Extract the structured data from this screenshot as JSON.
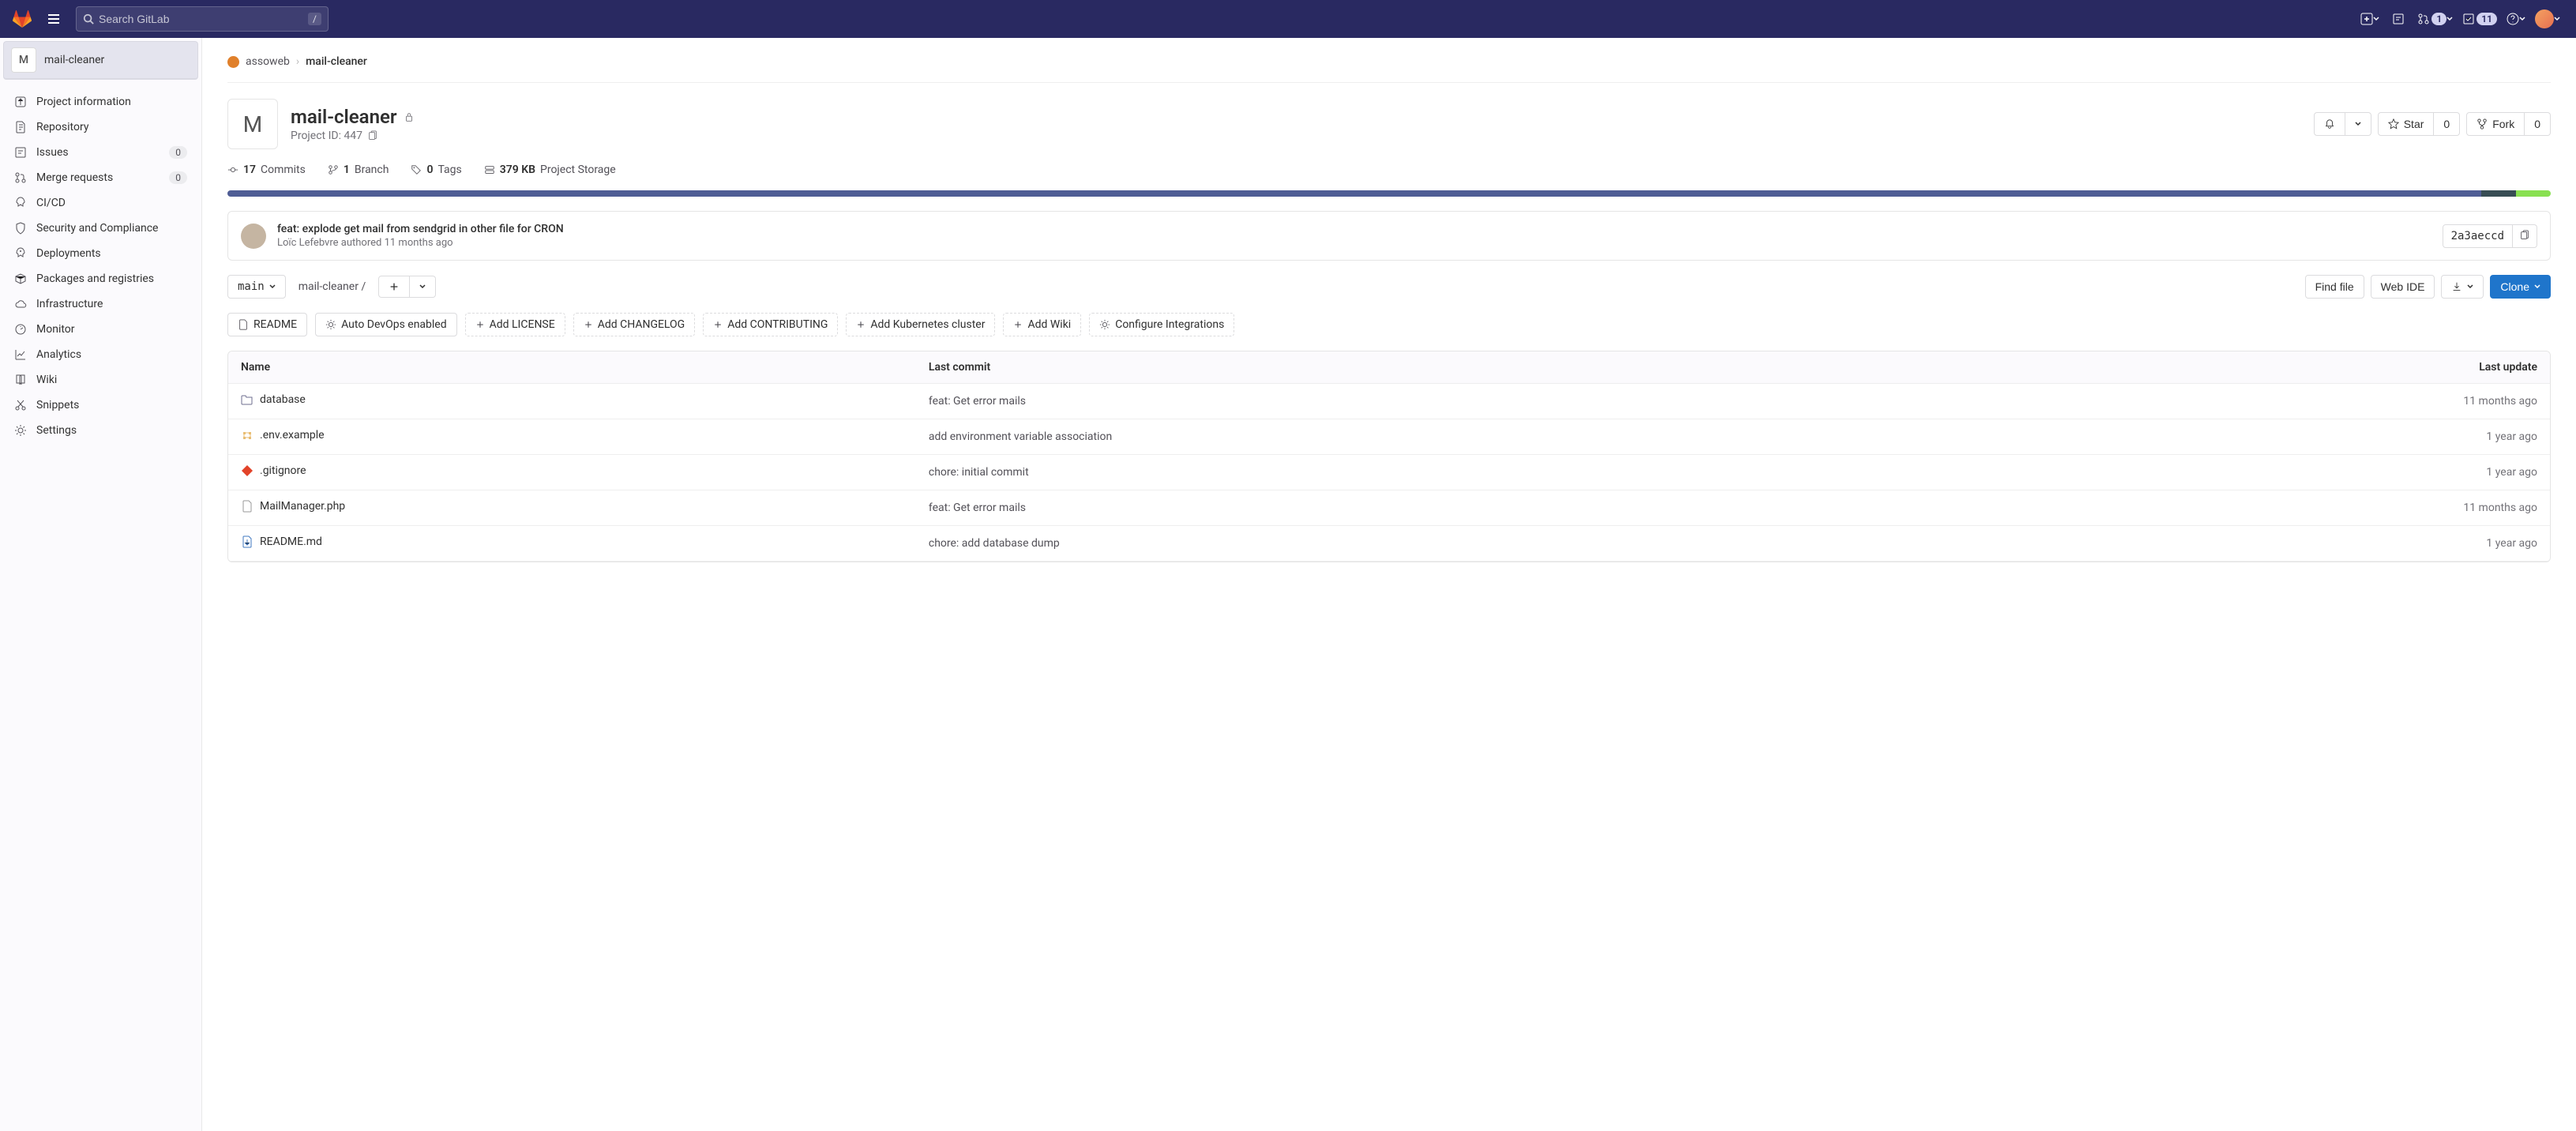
{
  "navbar": {
    "search_placeholder": "Search GitLab",
    "search_kbd": "/",
    "merge_badge": "1",
    "todo_badge": "11"
  },
  "sidebar": {
    "project_initial": "M",
    "project_name": "mail-cleaner",
    "items": [
      {
        "label": "Project information",
        "icon": "info"
      },
      {
        "label": "Repository",
        "icon": "repo"
      },
      {
        "label": "Issues",
        "icon": "issues",
        "count": "0"
      },
      {
        "label": "Merge requests",
        "icon": "merge",
        "count": "0"
      },
      {
        "label": "CI/CD",
        "icon": "rocket"
      },
      {
        "label": "Security and Compliance",
        "icon": "shield"
      },
      {
        "label": "Deployments",
        "icon": "deploy"
      },
      {
        "label": "Packages and registries",
        "icon": "package"
      },
      {
        "label": "Infrastructure",
        "icon": "cloud"
      },
      {
        "label": "Monitor",
        "icon": "monitor"
      },
      {
        "label": "Analytics",
        "icon": "chart"
      },
      {
        "label": "Wiki",
        "icon": "book"
      },
      {
        "label": "Snippets",
        "icon": "snippet"
      },
      {
        "label": "Settings",
        "icon": "gear"
      }
    ]
  },
  "breadcrumbs": {
    "group": "assoweb",
    "project": "mail-cleaner"
  },
  "hero": {
    "initial": "M",
    "title": "mail-cleaner",
    "project_id_label": "Project ID: 447",
    "star_label": "Star",
    "star_count": "0",
    "fork_label": "Fork",
    "fork_count": "0"
  },
  "stats": {
    "commits_count": "17",
    "commits_label": "Commits",
    "branches_count": "1",
    "branches_label": "Branch",
    "tags_count": "0",
    "tags_label": "Tags",
    "storage_size": "379 KB",
    "storage_label": "Project Storage"
  },
  "lang_bar": [
    {
      "color": "#4f5d95",
      "width": "97%"
    },
    {
      "color": "#384d54",
      "width": "1.5%"
    },
    {
      "color": "#89e051",
      "width": "1.5%"
    }
  ],
  "commit": {
    "message": "feat: explode get mail from sendgrid in other file for CRON",
    "author": "Loïc Lefebvre",
    "authored_word": "authored",
    "time": "11 months ago",
    "sha": "2a3aeccd"
  },
  "file_nav": {
    "branch": "main",
    "path": "mail-cleaner",
    "path_sep": "/",
    "find_file": "Find file",
    "web_ide": "Web IDE",
    "clone": "Clone"
  },
  "chips": {
    "readme": "README",
    "auto_devops": "Auto DevOps enabled",
    "add_license": "Add LICENSE",
    "add_changelog": "Add CHANGELOG",
    "add_contributing": "Add CONTRIBUTING",
    "add_k8s": "Add Kubernetes cluster",
    "add_wiki": "Add Wiki",
    "configure": "Configure Integrations"
  },
  "table": {
    "col_name": "Name",
    "col_commit": "Last commit",
    "col_update": "Last update",
    "rows": [
      {
        "icon": "folder",
        "name": "database",
        "commit": "feat: Get error mails",
        "date": "11 months ago"
      },
      {
        "icon": "env",
        "name": ".env.example",
        "commit": "add environment variable association",
        "date": "1 year ago"
      },
      {
        "icon": "git",
        "name": ".gitignore",
        "commit": "chore: initial commit",
        "date": "1 year ago"
      },
      {
        "icon": "file",
        "name": "MailManager.php",
        "commit": "feat: Get error mails",
        "date": "11 months ago"
      },
      {
        "icon": "readme",
        "name": "README.md",
        "commit": "chore: add database dump",
        "date": "1 year ago"
      }
    ]
  }
}
